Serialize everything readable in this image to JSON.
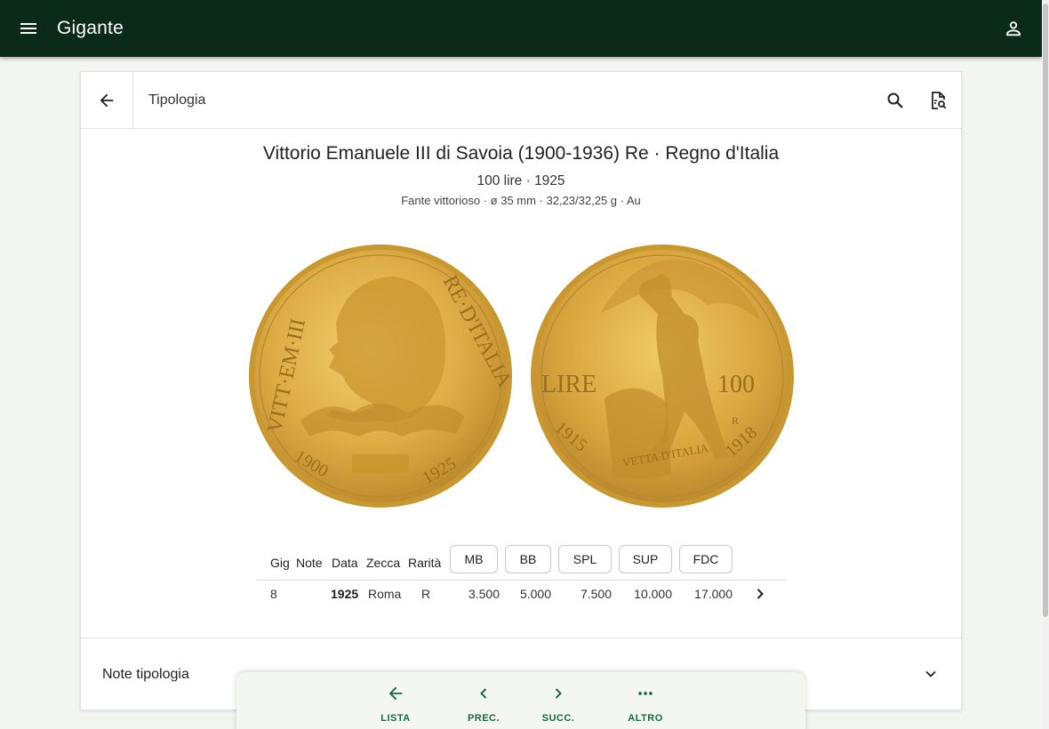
{
  "app": {
    "title": "Gigante"
  },
  "toolbar": {
    "breadcrumb": "Tipologia"
  },
  "coin": {
    "title": "Vittorio Emanuele III di Savoia (1900-1936) Re · Regno d'Italia",
    "subtitle": "100 lire · 1925",
    "details": "Fante vittorioso · ø 35 mm · 32,23/32,25 g · Au",
    "obverse": {
      "legend_left": "VITT·EM·III",
      "legend_right": "RE·D'ITALIA",
      "date_left": "1900",
      "date_right": "1925"
    },
    "reverse": {
      "left": "LIRE",
      "right": "100",
      "year_left": "1915",
      "year_right": "1918",
      "base": "VETTA D'ITALIA",
      "mint": "R"
    }
  },
  "table": {
    "headers": {
      "gig": "Gig",
      "note": "Note",
      "data": "Data",
      "zecca": "Zecca",
      "rarita": "Rarità"
    },
    "grades": [
      "MB",
      "BB",
      "SPL",
      "SUP",
      "FDC"
    ],
    "row": {
      "gig": "8",
      "note": "",
      "data": "1925",
      "zecca": "Roma",
      "rarita": "R",
      "prices": [
        "3.500",
        "5.000",
        "7.500",
        "10.000",
        "17.000"
      ]
    }
  },
  "notes": {
    "label": "Note tipologia"
  },
  "bottom_nav": {
    "items": [
      {
        "label": "LISTA",
        "icon": "arrow-left-icon"
      },
      {
        "label": "PREC.",
        "icon": "chevron-left-icon"
      },
      {
        "label": "SUCC.",
        "icon": "chevron-right-icon"
      },
      {
        "label": "ALTRO",
        "icon": "more-horiz-icon"
      }
    ],
    "accent": "#1b6b3a"
  },
  "colors": {
    "appbar": "#0b2a1a",
    "gold": "#d9a93f"
  }
}
